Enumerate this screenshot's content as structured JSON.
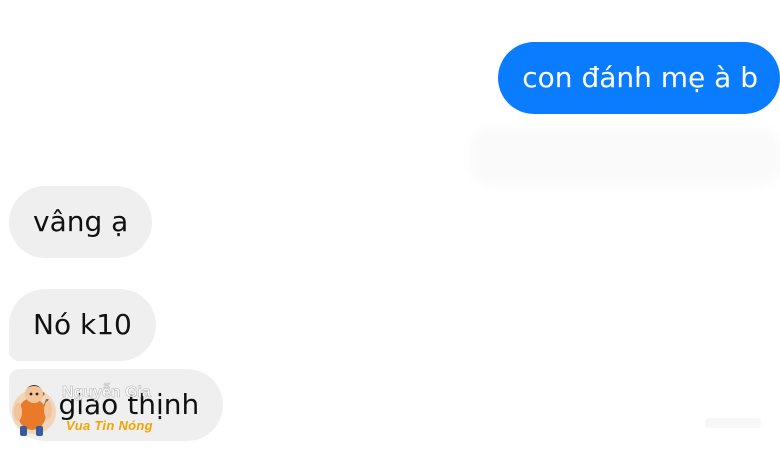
{
  "messages": {
    "sent": [
      {
        "text": "con đánh mẹ à b"
      }
    ],
    "received": [
      {
        "text": "vâng ạ"
      },
      {
        "text": "Nó k10"
      },
      {
        "text": "ỷ giao thịnh"
      }
    ]
  },
  "watermark": {
    "brand_line_1": "Nguyễn Gia",
    "brand_line_2": "Vua Tin Nóng"
  },
  "colors": {
    "sent_bubble": "#0a7cff",
    "received_bubble": "#efefef",
    "background": "#ffffff"
  }
}
